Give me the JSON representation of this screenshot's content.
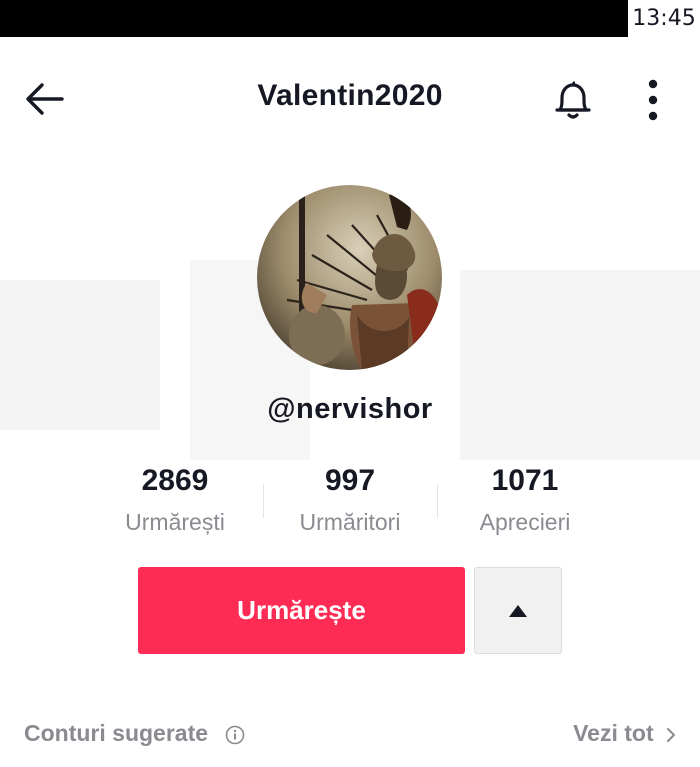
{
  "status_bar": {
    "time": "13:45"
  },
  "header": {
    "title": "Valentin2020",
    "back_icon": "arrow-left-icon",
    "bell_icon": "bell-icon",
    "more_icon": "more-vertical-icon"
  },
  "profile": {
    "handle": "@nervishor",
    "avatar": "spartan-warrior-avatar"
  },
  "stats": [
    {
      "value": "2869",
      "label": "Urmărești"
    },
    {
      "value": "997",
      "label": "Urmăritori"
    },
    {
      "value": "1071",
      "label": "Aprecieri"
    }
  ],
  "actions": {
    "follow_label": "Urmărește",
    "suggest_icon": "caret-up-icon"
  },
  "suggested": {
    "label": "Conturi sugerate",
    "see_all": "Vezi tot"
  },
  "colors": {
    "accent": "#fe2c55",
    "text_primary": "#161823",
    "text_secondary": "#8a8b91"
  }
}
